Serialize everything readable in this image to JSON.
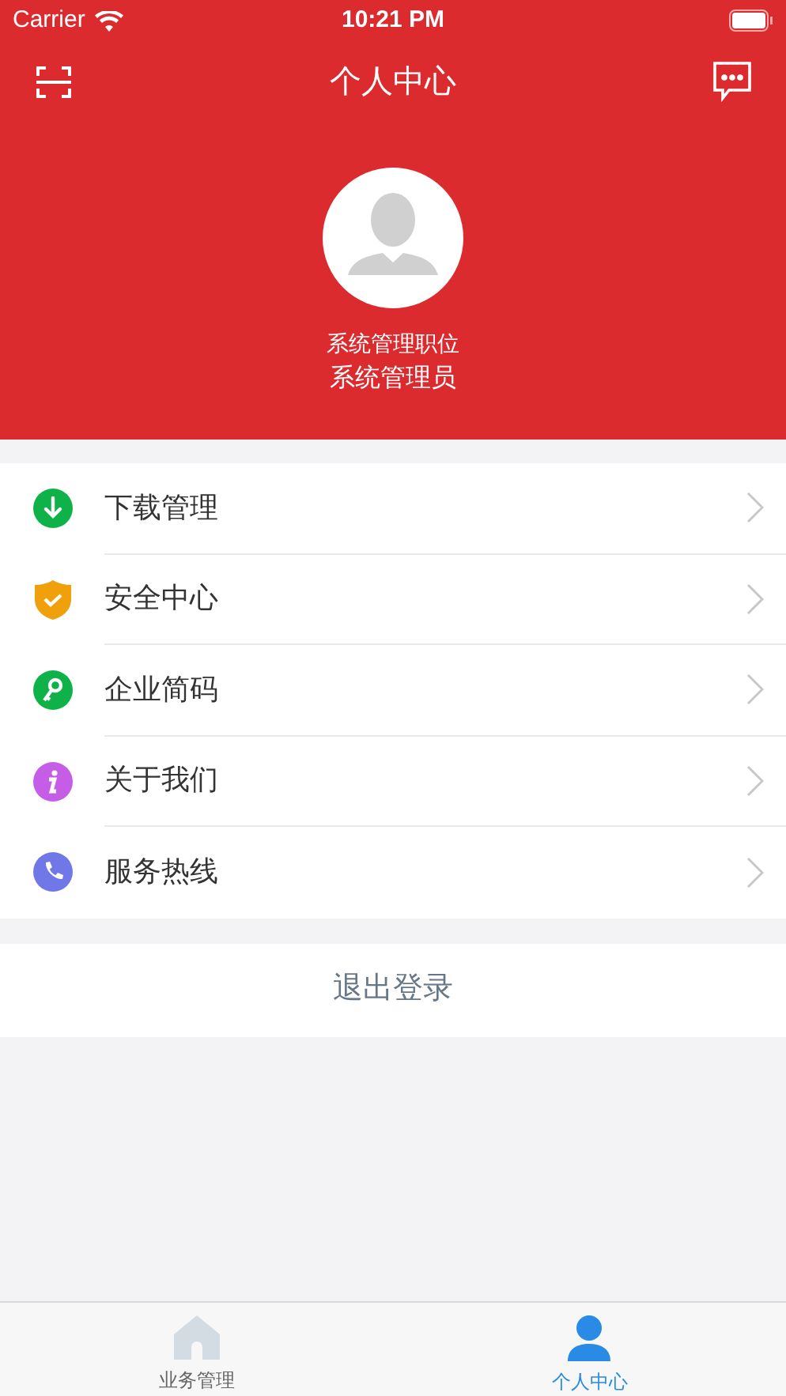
{
  "status_bar": {
    "carrier": "Carrier",
    "time": "10:21 PM"
  },
  "nav": {
    "title": "个人中心"
  },
  "profile": {
    "position": "系统管理职位",
    "name": "系统管理员"
  },
  "menu": [
    {
      "kind": "download",
      "label": "下载管理",
      "color": "#0fb248"
    },
    {
      "kind": "shield",
      "label": "安全中心",
      "color": "#f0a00a"
    },
    {
      "kind": "key",
      "label": "企业简码",
      "color": "#0fb248"
    },
    {
      "kind": "info",
      "label": "关于我们",
      "color": "#c55de6"
    },
    {
      "kind": "phone",
      "label": "服务热线",
      "color": "#6f78e6"
    }
  ],
  "logout": "退出登录",
  "tabs": [
    {
      "kind": "home",
      "label": "业务管理",
      "selected": false
    },
    {
      "kind": "person",
      "label": "个人中心",
      "selected": true
    }
  ]
}
